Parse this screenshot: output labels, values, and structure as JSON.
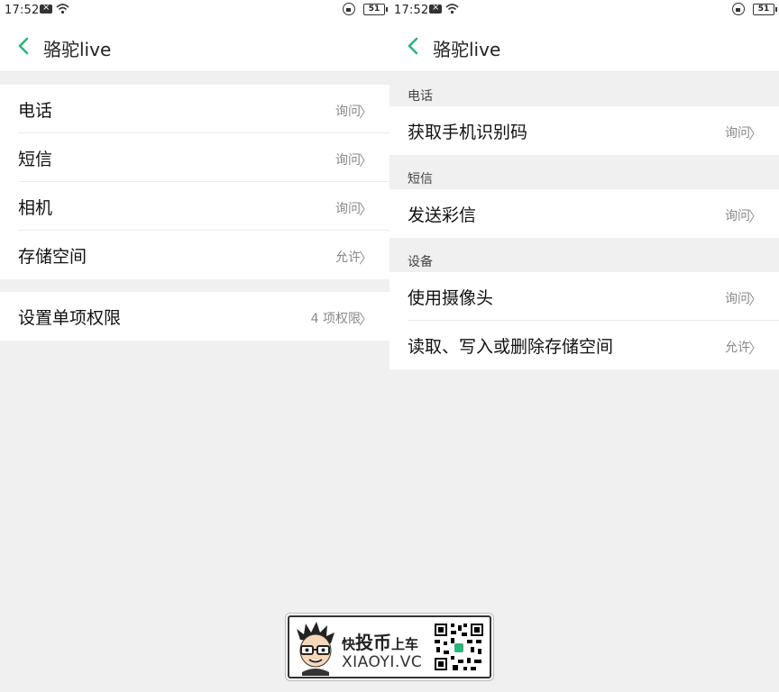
{
  "left": {
    "status": {
      "time": "17:52",
      "battery": "51"
    },
    "title": "骆驼live",
    "permissions": [
      {
        "label": "电话",
        "value": "询问"
      },
      {
        "label": "短信",
        "value": "询问"
      },
      {
        "label": "相机",
        "value": "询问"
      },
      {
        "label": "存储空间",
        "value": "允许"
      }
    ],
    "single": {
      "label": "设置单项权限",
      "value": "4 项权限"
    }
  },
  "right": {
    "status": {
      "time": "17:52",
      "battery": "51"
    },
    "title": "骆驼live",
    "sections": [
      {
        "header": "电话",
        "items": [
          {
            "label": "获取手机识别码",
            "value": "询问"
          }
        ]
      },
      {
        "header": "短信",
        "items": [
          {
            "label": "发送彩信",
            "value": "询问"
          }
        ]
      },
      {
        "header": "设备",
        "items": [
          {
            "label": "使用摄像头",
            "value": "询问"
          },
          {
            "label": "读取、写入或删除存储空间",
            "value": "允许"
          }
        ]
      }
    ]
  },
  "watermark": {
    "slogan_pre": "快",
    "slogan_main": "投币",
    "slogan_post": "上车",
    "site": "XIAOYI.VC"
  },
  "colors": {
    "accent": "#2bb57b",
    "background": "#f0f0f0",
    "secondary_text": "#888888"
  },
  "icons": {
    "back": "chevron-left-icon",
    "row_arrow": "chevron-right-icon"
  }
}
